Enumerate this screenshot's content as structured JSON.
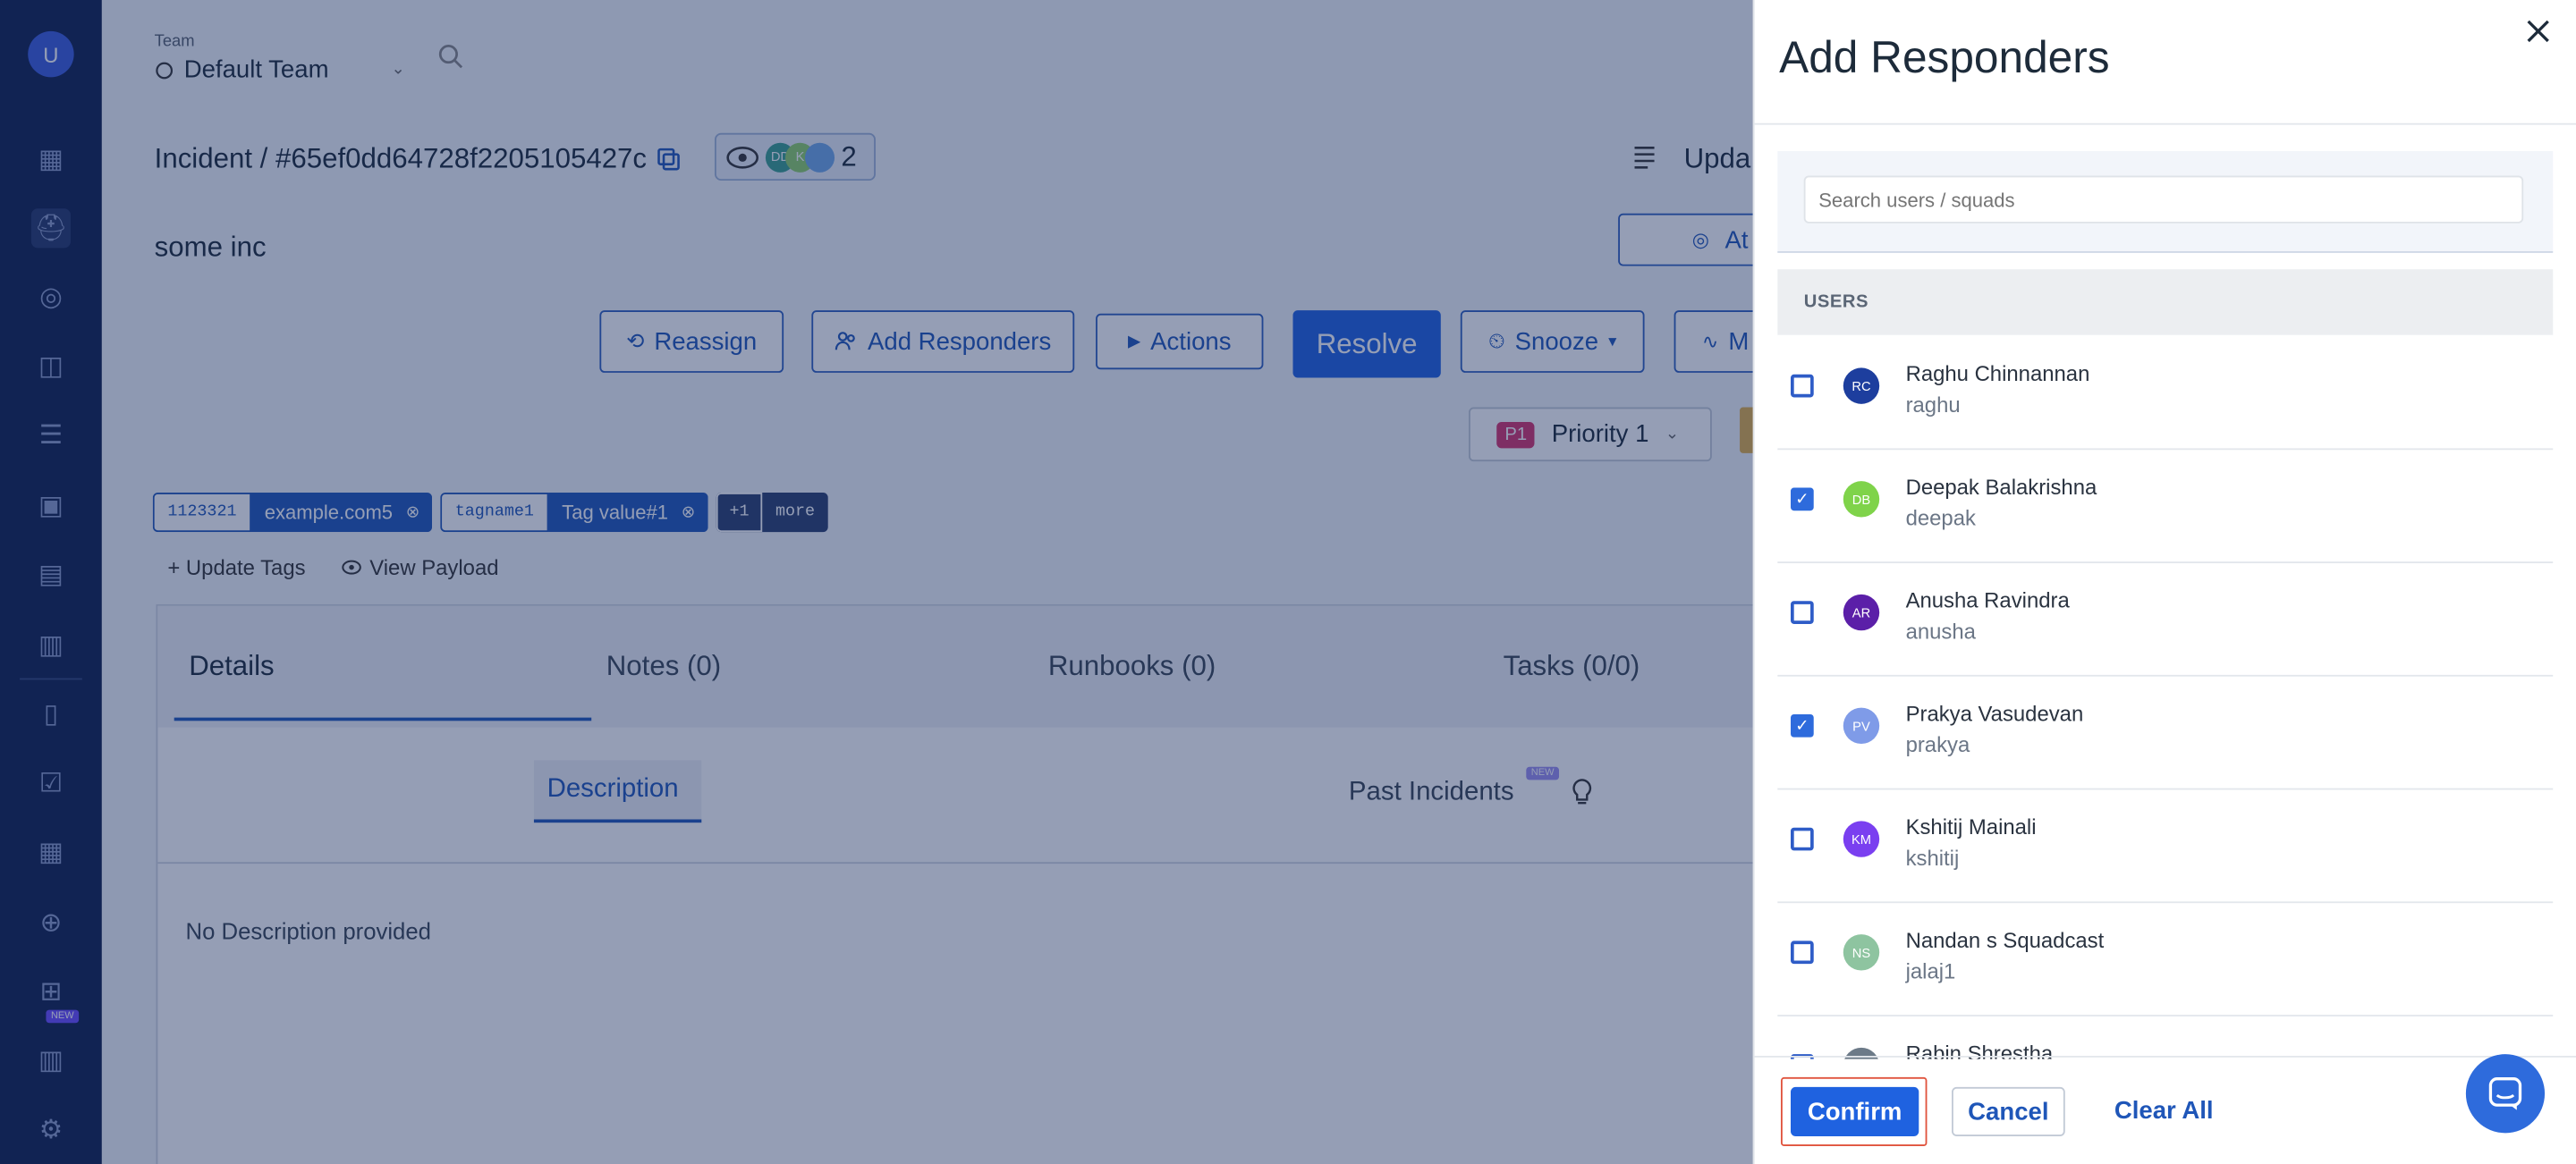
{
  "sidebar": {
    "avatar_letter": "U",
    "new_badge": "NEW",
    "icons": [
      "dashboard-icon",
      "incidents-icon",
      "target-icon",
      "analytics-icon",
      "services-icon",
      "calendar-icon",
      "schedule-icon",
      "clipboard-icon",
      "runbook-icon",
      "checklist-icon",
      "table-icon",
      "globe-icon",
      "workflow-icon",
      "reports-icon",
      "settings-icon"
    ]
  },
  "header": {
    "team_label": "Team",
    "team_name": "Default Team"
  },
  "incident": {
    "title": "Incident / #65ef0dd64728f2205105427c",
    "watcher_initials": [
      "DD",
      "K",
      ""
    ],
    "watcher_count": "2",
    "update_label": "Upda",
    "name": "some inc",
    "attach_label": "At",
    "buttons": {
      "reassign": "Reassign",
      "add_responders": "Add Responders",
      "actions": "Actions",
      "resolve": "Resolve",
      "snooze": "Snooze",
      "more": "M"
    },
    "priority_badge": "P1",
    "priority_label": "Priority 1",
    "tags": [
      {
        "key": "1123321",
        "value": "example.com5"
      },
      {
        "key": "tagname1",
        "value": "Tag value#1"
      }
    ],
    "more_tags_count": "+1",
    "more_tags_label": "more",
    "update_tags": "+ Update Tags",
    "view_payload": "View Payload",
    "tabs": [
      "Details",
      "Notes (0)",
      "Runbooks (0)",
      "Tasks (0/0)"
    ],
    "subtabs": {
      "description": "Description",
      "past_incidents": "Past Incidents",
      "new_badge": "NEW"
    },
    "description_text": "No Description provided"
  },
  "panel": {
    "title": "Add Responders",
    "search_placeholder": "Search users / squads",
    "section_header": "USERS",
    "users": [
      {
        "initials": "RC",
        "name": "Raghu Chinnannan",
        "username": "raghu",
        "checked": false,
        "color": "#1d3e9e"
      },
      {
        "initials": "DB",
        "name": "Deepak Balakrishna",
        "username": "deepak",
        "checked": true,
        "color": "#7fd34a"
      },
      {
        "initials": "AR",
        "name": "Anusha Ravindra",
        "username": "anusha",
        "checked": false,
        "color": "#5b1fa8"
      },
      {
        "initials": "PV",
        "name": "Prakya Vasudevan",
        "username": "prakya",
        "checked": true,
        "color": "#7f9be8"
      },
      {
        "initials": "KM",
        "name": "Kshitij Mainali",
        "username": "kshitij",
        "checked": false,
        "color": "#7a3ff0"
      },
      {
        "initials": "NS",
        "name": "Nandan s Squadcast",
        "username": "jalaj1",
        "checked": false,
        "color": "#8ec4a0"
      },
      {
        "initials": "RS",
        "name": "Rabin Shrestha",
        "username": "",
        "checked": false,
        "color": "#6c7a88"
      }
    ],
    "confirm": "Confirm",
    "cancel": "Cancel",
    "clear_all": "Clear All"
  },
  "colors": {
    "primary": "#1f62e0",
    "sidebar": "#0f1f4d",
    "highlight": "#e0533d"
  }
}
